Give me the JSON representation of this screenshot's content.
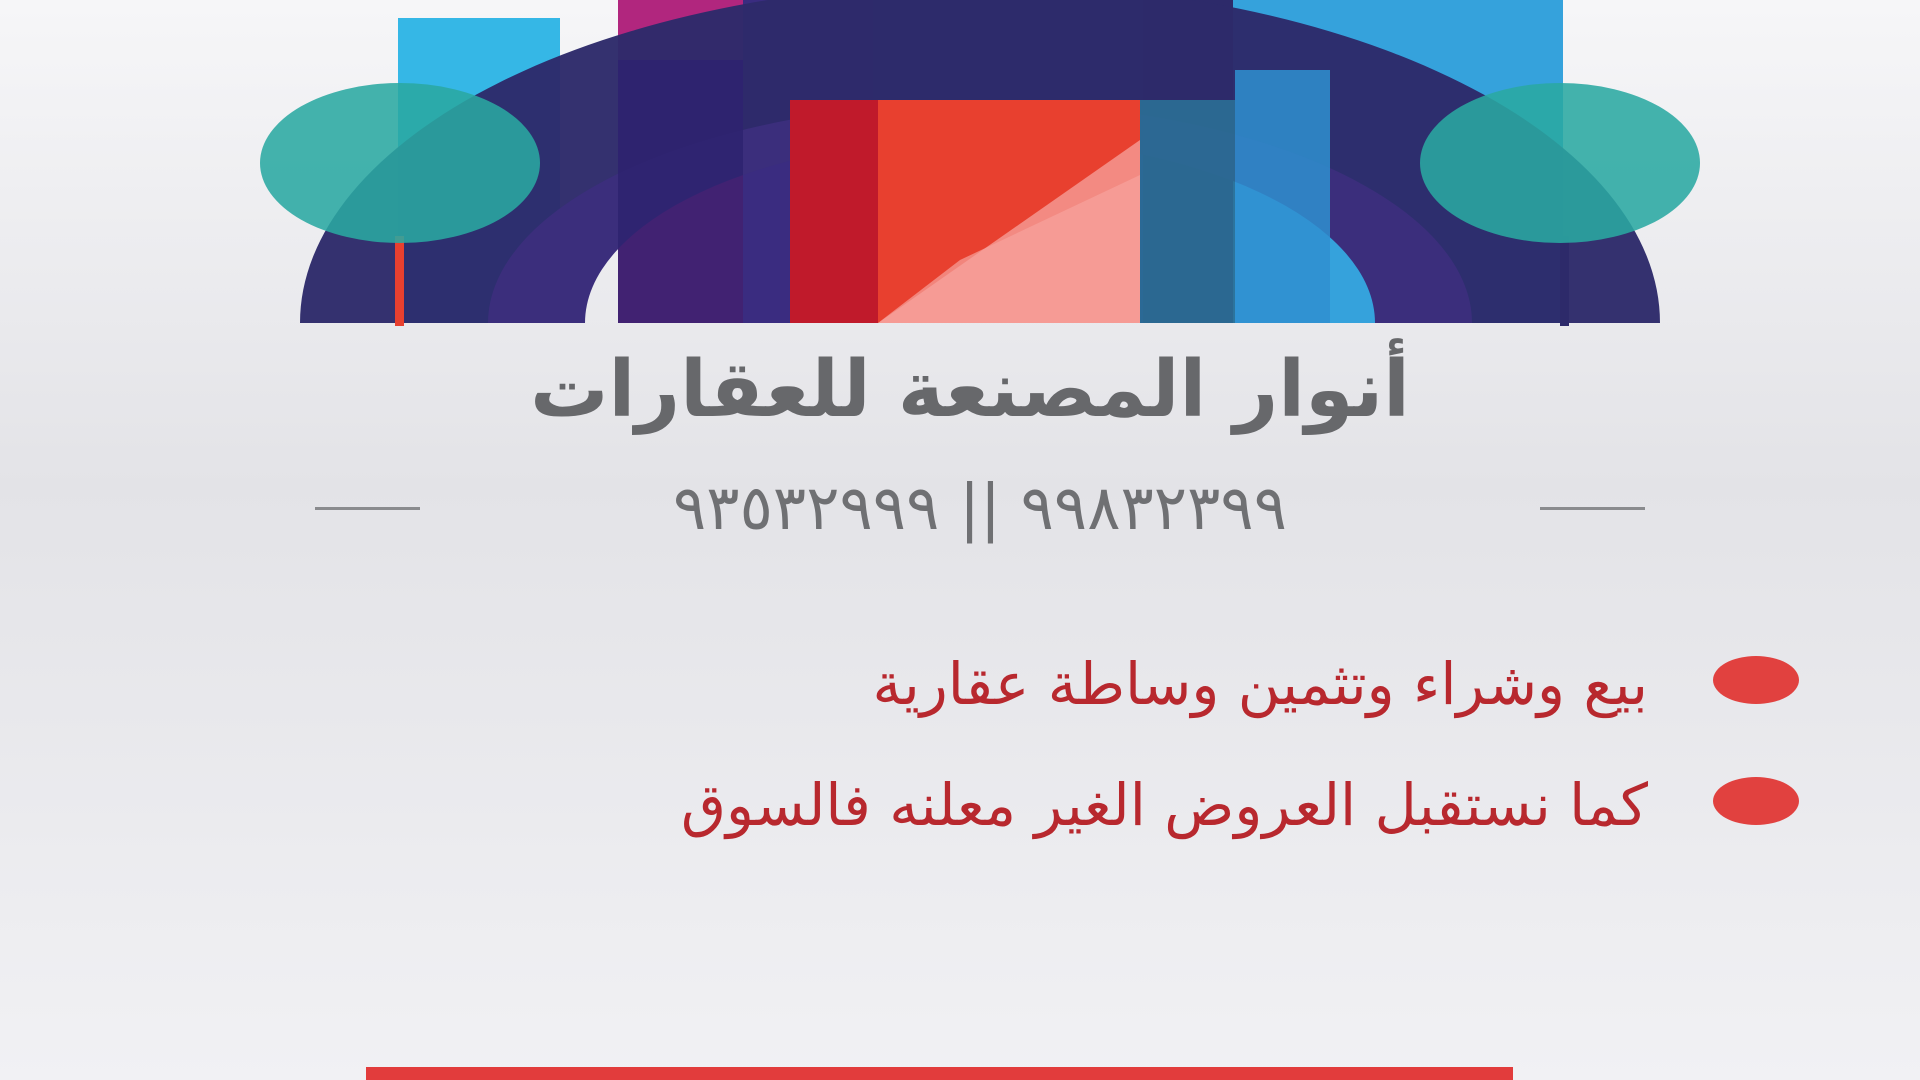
{
  "logo": {
    "icon": "buildings-arch-logo-icon",
    "colors": {
      "arch": "#2d2a6a",
      "blue": "#35b7e6",
      "magenta": "#b1267e",
      "red": "#e8402f",
      "teal": "#2aa9a2"
    }
  },
  "brand": {
    "name": "أنوار المصنعة للعقارات",
    "color": "#67686b"
  },
  "contact": {
    "phones": "٩٩٨٣٢٣٩٩ || ٩٣٥٣٢٩٩٩"
  },
  "services": [
    {
      "text": "بيع وشراء وتثمين وساطة عقارية"
    },
    {
      "text": "كما نستقبل العروض الغير معلنه فالسوق"
    }
  ],
  "accent": "#e1413f"
}
